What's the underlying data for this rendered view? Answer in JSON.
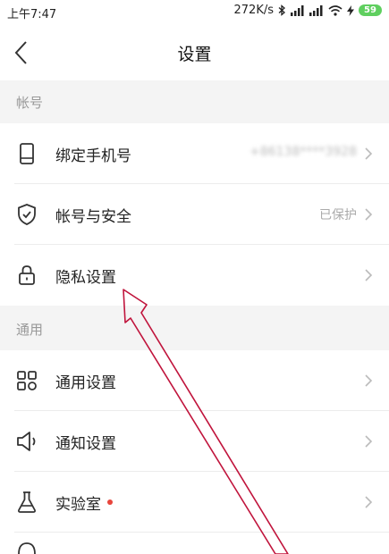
{
  "status_bar": {
    "time": "上午7:47",
    "network_speed": "272K/s",
    "battery_level": "59",
    "icons": [
      "bluetooth-icon",
      "signal-icon",
      "signal-icon",
      "wifi-icon",
      "charging-icon",
      "battery-icon"
    ]
  },
  "nav": {
    "title": "设置",
    "back_icon": "chevron-left-icon"
  },
  "sections": {
    "account": {
      "header": "帐号"
    },
    "general": {
      "header": "通用"
    }
  },
  "rows": {
    "bind_phone": {
      "label": "绑定手机号",
      "value": "+86138****3928",
      "icon": "phone-icon"
    },
    "account_security": {
      "label": "帐号与安全",
      "value": "已保护",
      "icon": "shield-icon"
    },
    "privacy": {
      "label": "隐私设置",
      "icon": "lock-icon"
    },
    "general_settings": {
      "label": "通用设置",
      "icon": "grid-icon"
    },
    "notification_settings": {
      "label": "通知设置",
      "icon": "speaker-icon"
    },
    "lab": {
      "label": "实验室",
      "icon": "flask-icon"
    }
  },
  "colors": {
    "accent_red": "#e8453c",
    "annotation_arrow": "#c0143c",
    "section_bg": "#f4f4f4"
  }
}
